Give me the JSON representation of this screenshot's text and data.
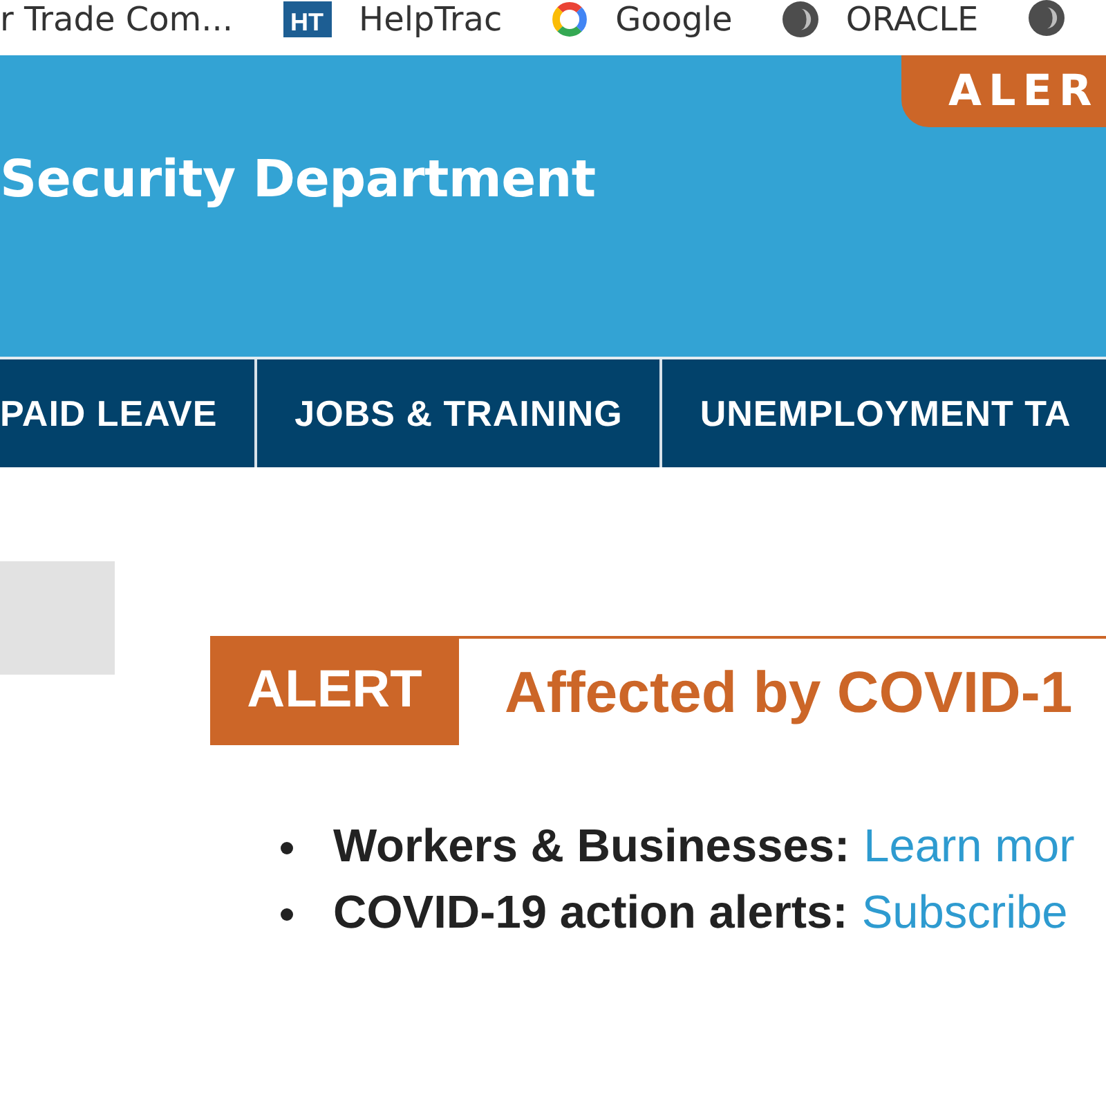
{
  "bookmarks": [
    {
      "kind": "plain",
      "label": "r Trade Com..."
    },
    {
      "kind": "tile",
      "tile_text": "HT",
      "label": "HelpTrac"
    },
    {
      "kind": "ring",
      "label": "Google"
    },
    {
      "kind": "disc",
      "label": "ORACLE"
    },
    {
      "kind": "disc"
    }
  ],
  "header": {
    "title": "Security Department",
    "alert_tab": "ALER"
  },
  "nav": {
    "items": [
      {
        "label": "PAID LEAVE"
      },
      {
        "label": "JOBS & TRAINING"
      },
      {
        "label": "UNEMPLOYMENT TA"
      }
    ]
  },
  "alert": {
    "badge": "ALERT",
    "heading": "Affected by COVID-1",
    "items": [
      {
        "label": "Workers & Businesses:",
        "link": "Learn mor"
      },
      {
        "label": "COVID-19 action alerts:",
        "link": "Subscribe"
      }
    ]
  }
}
